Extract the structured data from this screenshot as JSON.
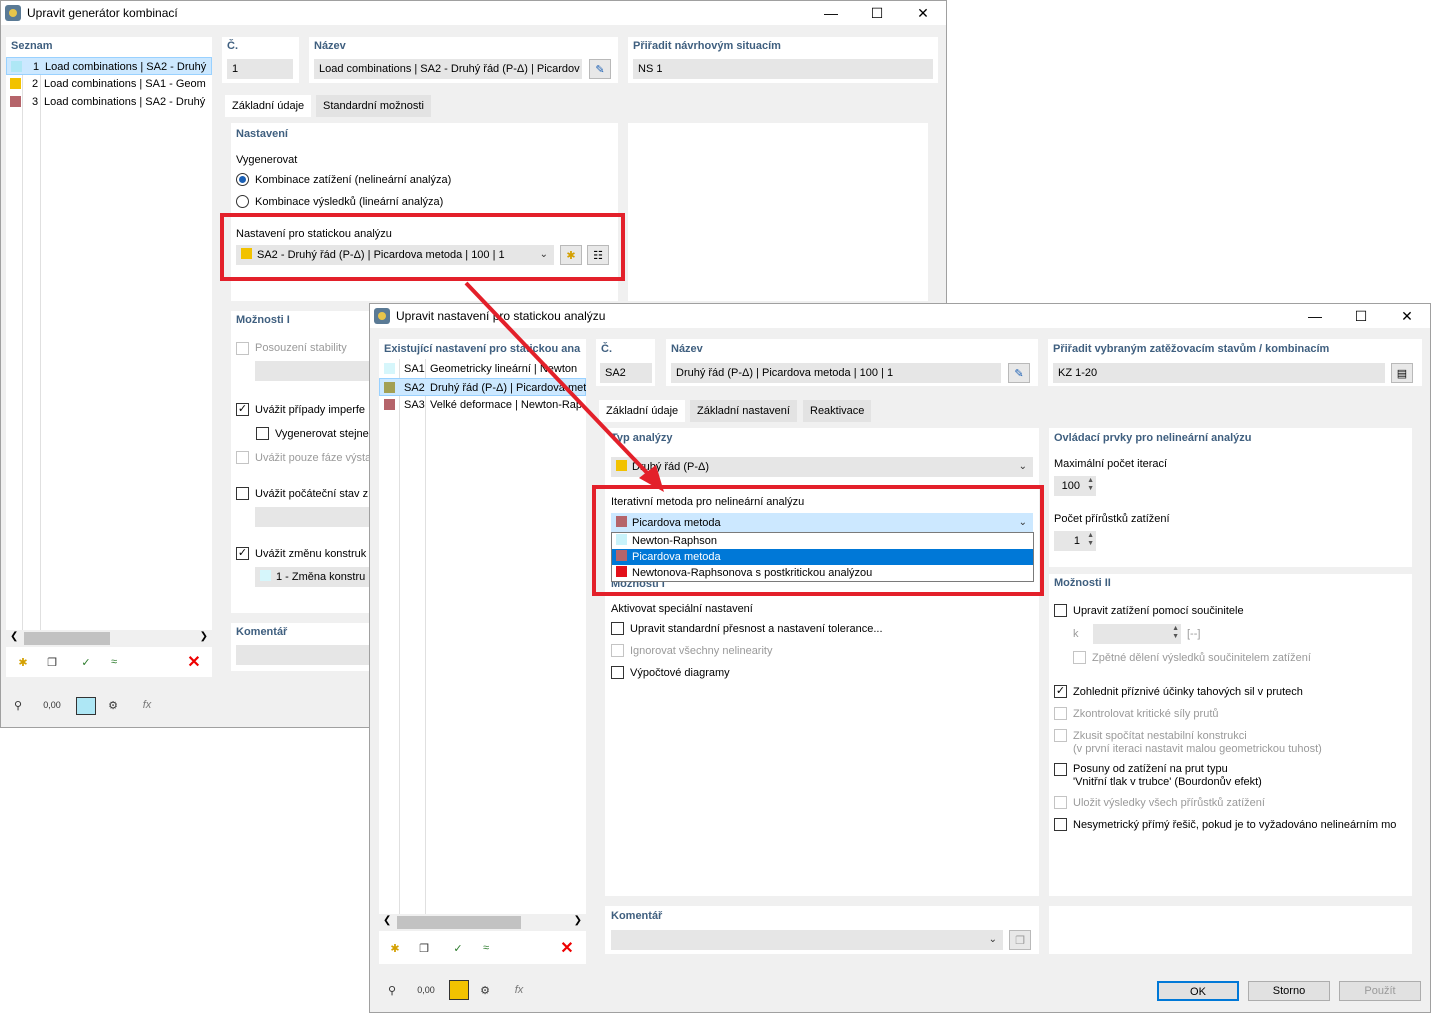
{
  "back": {
    "title": "Upravit generátor kombinací",
    "list_header": "Seznam",
    "list": [
      {
        "num": "1",
        "label": "Load combinations | SA2 - Druhý",
        "color": "#aee7f5"
      },
      {
        "num": "2",
        "label": "Load combinations | SA1 - Geom",
        "color": "#f2c200"
      },
      {
        "num": "3",
        "label": "Load combinations | SA2 - Druhý",
        "color": "#b5646a"
      }
    ],
    "no_label": "Č.",
    "no_value": "1",
    "name_label": "Název",
    "name_value": "Load combinations | SA2 - Druhý řád (P-Δ) | Picardov",
    "assign_label": "Přiřadit návrhovým situacím",
    "assign_value": "NS 1",
    "tabs": [
      "Základní údaje",
      "Standardní možnosti"
    ],
    "settings_header": "Nastavení",
    "generate_label": "Vygenerovat",
    "radio1": "Kombinace zatížení (nelineární analýza)",
    "radio2": "Kombinace výsledků (lineární analýza)",
    "static_label": "Nastavení pro statickou analýzu",
    "static_value": "SA2 - Druhý řád (P-Δ) | Picardova metoda | 100 | 1",
    "options_header": "Možnosti I",
    "opt_stability": "Posouzení stability",
    "opt_imperf": "Uvážit případy imperfe",
    "opt_generate_same": "Vygenerovat stejne",
    "opt_phases": "Uvážit pouze fáze výsta",
    "opt_initial": "Uvážit počáteční stav z",
    "opt_change": "Uvážit změnu konstruk",
    "change_value": "1 - Změna konstru",
    "comment_header": "Komentář"
  },
  "front": {
    "title": "Upravit nastavení pro statickou analýzu",
    "list_header": "Existující nastavení pro statickou ana",
    "list": [
      {
        "code": "SA1",
        "label": "Geometricky lineární | Newton",
        "color": "#d6f6fb"
      },
      {
        "code": "SA2",
        "label": "Druhý řád (P-Δ) | Picardova met",
        "color": "#a3a054"
      },
      {
        "code": "SA3",
        "label": "Velké deformace | Newton-Rap",
        "color": "#b5646a"
      }
    ],
    "no_label": "Č.",
    "no_value": "SA2",
    "name_label": "Název",
    "name_value": "Druhý řád (P-Δ) | Picardova metoda | 100 | 1",
    "assign_label": "Přiřadit vybraným zatěžovacím stavům / kombinacím",
    "assign_value": "KZ 1-20",
    "tabs": [
      "Základní údaje",
      "Základní nastavení",
      "Reaktivace"
    ],
    "analysis_type_header": "Typ analýzy",
    "analysis_type_value": "Druhý řád (P-Δ)",
    "iter_label": "Iterativní metoda pro nelineární analýzu",
    "iter_value": "Picardova metoda",
    "iter_options": [
      {
        "label": "Newton-Raphson",
        "color": "#c8f2fa"
      },
      {
        "label": "Picardova metoda",
        "color": "#b5646a"
      },
      {
        "label": "Newtonova-Raphsonova s postkritickou analýzou",
        "color": "#e3101a"
      }
    ],
    "options1_header": "Možnosti I",
    "special_label": "Aktivovat speciální nastavení",
    "opt_precision": "Upravit standardní přesnost a nastavení tolerance...",
    "opt_ignore": "Ignorovat všechny nelinearity",
    "opt_diagrams": "Výpočtové diagramy",
    "comment_header": "Komentář",
    "controls_header": "Ovládací prvky pro nelineární analýzu",
    "max_iter_label": "Maximální počet iterací",
    "max_iter_value": "100",
    "increments_label": "Počet přírůstků zatížení",
    "increments_value": "1",
    "options2_header": "Možnosti II",
    "opt_factor": "Upravit zatížení pomocí součinitele",
    "k_label": "k",
    "k_unit": "[--]",
    "opt_back_divide": "Zpětné dělení výsledků součinitelem zatížení",
    "opt_tension": "Zohlednit příznivé účinky tahových sil v prutech",
    "opt_critical": "Zkontrolovat kritické síly prutů",
    "opt_unstable_1": "Zkusit spočítat nestabilní konstrukci",
    "opt_unstable_2": "(v první iteraci nastavit malou geometrickou tuhost)",
    "opt_bourdon_1": "Posuny od zatížení na prut typu",
    "opt_bourdon_2": "'Vnitřní tlak v trubce' (Bourdonův efekt)",
    "opt_save_all": "Uložit výsledky všech přírůstků zatížení",
    "opt_nonsym": "Nesymetrický přímý řešič, pokud je to vyžadováno nelineárním mo",
    "ok": "OK",
    "cancel": "Storno",
    "apply": "Použít"
  },
  "icons": {
    "zero_value": "0,00"
  }
}
